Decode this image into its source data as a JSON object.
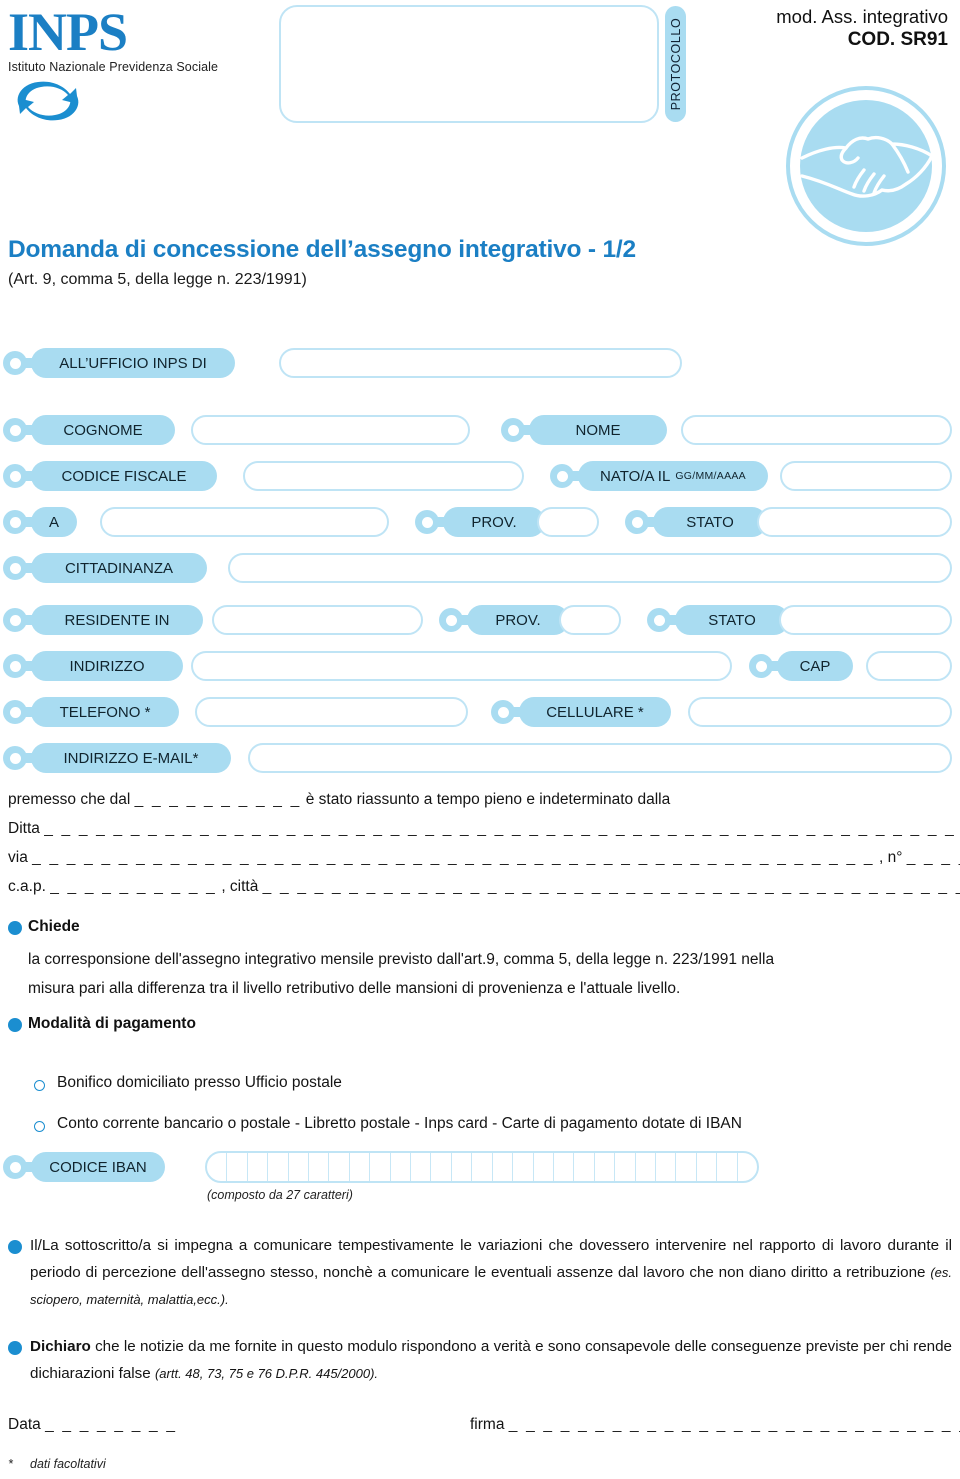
{
  "header": {
    "logo_word": "INPS",
    "logo_subtitle": "Istituto Nazionale Previdenza Sociale",
    "protocollo_label": "PROTOCOLLO",
    "mod_line": "mod. Ass. integrativo",
    "cod_line": "COD. SR91"
  },
  "title": {
    "main": "Domanda di concessione dell’assegno integrativo - 1/2",
    "subtitle": "(Art. 9, comma 5, della legge n. 223/1991)"
  },
  "fields": {
    "ufficio": "ALL’UFFICIO INPS DI",
    "cognome": "COGNOME",
    "nome": "NOME",
    "codice_fiscale": "CODICE FISCALE",
    "nato_il": "NATO/A IL",
    "nato_il_format": "GG/MM/AAAA",
    "a": "A",
    "prov1": "PROV.",
    "stato1": "STATO",
    "cittadinanza": "CITTADINANZA",
    "residente_in": "RESIDENTE IN",
    "prov2": "PROV.",
    "stato2": "STATO",
    "indirizzo": "INDIRIZZO",
    "cap": "CAP",
    "telefono": "TELEFONO *",
    "cellulare": "CELLULARE *",
    "email": "INDIRIZZO E-MAIL*",
    "codice_iban": "CODICE IBAN",
    "iban_cells": 27,
    "iban_note": "(composto da 27 caratteri)"
  },
  "premessa": {
    "line1_a": "premesso che dal",
    "line1_blank": "_ _ _ _ _ _ _ _ _ _",
    "line1_b": "è stato riassunto a tempo pieno e indeterminato dalla",
    "line2_a": "Ditta",
    "line2_blank": "_ _ _ _ _ _ _ _ _ _ _ _ _ _ _ _ _ _ _ _ _ _ _ _ _ _ _ _ _ _ _ _ _ _ _ _ _ _ _ _ _ _ _ _ _ _ _ _ _ _ _ _ _ _ _ _ _ _ _ _ _",
    "line2_end": ",",
    "line3_a": "via",
    "line3_blank": "_ _ _ _ _ _ _ _ _ _ _ _ _ _ _ _ _ _ _ _ _ _ _ _ _ _ _ _ _ _ _ _ _ _ _ _ _ _ _ _ _ _ _ _ _ _ _ _ _",
    "line3_mid": ", n°",
    "line3_blank2": "_ _ _ _ _ _ _ _ _ _ _ _ _",
    "line3_end": ",",
    "line4_a": "c.a.p.",
    "line4_blank": "_ _ _ _ _ _ _ _ _ _",
    "line4_mid": ", città",
    "line4_blank2": "_ _ _ _ _ _ _ _ _ _ _ _ _ _ _ _ _ _ _ _ _ _ _ _ _ _ _ _ _ _ _ _ _ _ _ _ _ _ _ _ _ _ _ _ _ _"
  },
  "chiede": {
    "heading": "Chiede",
    "body_line1": "la corresponsione dell'assegno integrativo mensile previsto dall'art.9, comma 5, della legge n. 223/1991 nella",
    "body_line2": "misura pari alla differenza tra il livello retributivo delle mansioni di provenienza e l'attuale livello."
  },
  "pagamento": {
    "heading": "Modalità di pagamento",
    "option1": "Bonifico domiciliato presso Ufficio postale",
    "option2": "Conto corrente bancario o postale - Libretto postale - Inps card - Carte di pagamento dotate di IBAN"
  },
  "impegno": {
    "text": "Il/La sottoscritto/a si impegna a comunicare tempestivamente le variazioni che dovessero intervenire nel rapporto di lavoro durante il periodo di percezione dell'assegno stesso, nonchè a comunicare le eventuali assenze dal lavoro che non diano diritto a retribuzione ",
    "italic_tail": "(es. sciopero, maternità, malattia,ecc.)."
  },
  "dichiaro": {
    "bold_word": "Dichiaro",
    "text": " che le notizie da me fornite in questo modulo rispondono a verità e sono consapevole delle conseguenze previste per chi rende dichiarazioni false ",
    "italic_tail": "(artt. 48, 73, 75 e 76 D.P.R. 445/2000)."
  },
  "footer": {
    "data_label": "Data",
    "data_blank": "_ _ _ _ _ _ _ _",
    "firma_label": "firma",
    "firma_blank": "_ _ _ _ _ _ _ _ _ _ _ _ _ _ _ _ _ _ _ _ _ _ _ _ _ _ _",
    "footnote_star": "*",
    "footnote_text": "dati facoltativi"
  },
  "colors": {
    "brand_blue": "#1b7fc4",
    "tag_fill": "#a9dcf1",
    "box_border": "#bfe4f5",
    "bullet_blue": "#1b8ed0"
  }
}
